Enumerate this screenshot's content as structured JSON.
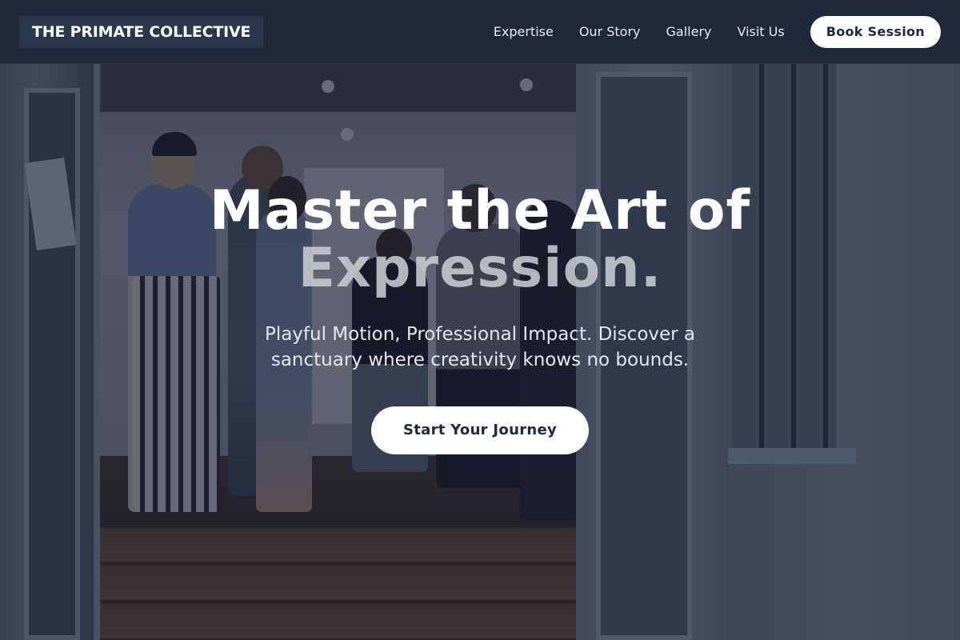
{
  "header": {
    "logo": "THE PRIMATE COLLECTIVE",
    "nav": [
      {
        "label": "Expertise"
      },
      {
        "label": "Our Story"
      },
      {
        "label": "Gallery"
      },
      {
        "label": "Visit Us"
      }
    ],
    "book_button": "Book Session"
  },
  "hero": {
    "title_line1": "Master the Art of",
    "title_line2": "Expression.",
    "subtitle": "Playful Motion, Professional Impact. Discover a sanctuary where creativity knows no bounds.",
    "cta_label": "Start Your Journey",
    "background_image": "gallery-opening-photo"
  },
  "colors": {
    "header_bg": "#1e293b",
    "button_bg": "#ffffff",
    "button_text": "#1e293b",
    "overlay": "#161c30"
  }
}
